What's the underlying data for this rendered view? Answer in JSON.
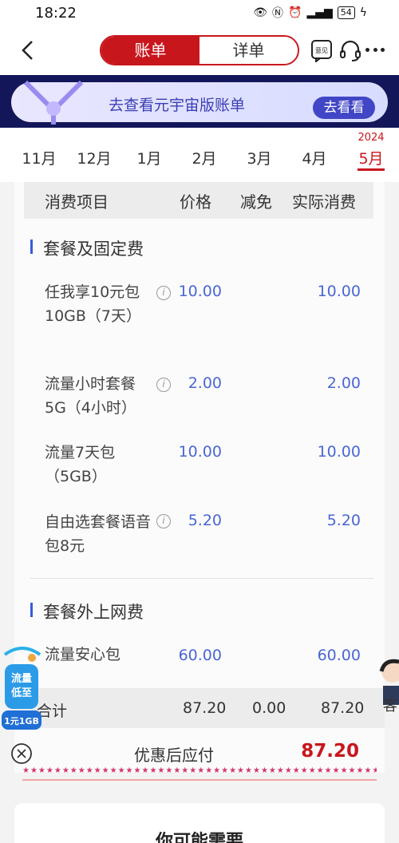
{
  "status_bar": {
    "time": "18:22",
    "battery": "54"
  },
  "header": {
    "tabs": [
      {
        "label": "账单",
        "active": true
      },
      {
        "label": "详单",
        "active": false
      }
    ],
    "badge_icon_label": "意见"
  },
  "banner": {
    "text": "去查看元宇宙版账单",
    "button": "去看看"
  },
  "months": {
    "items": [
      "11月",
      "12月",
      "1月",
      "2月",
      "3月",
      "4月",
      "5月"
    ],
    "active_year": "2024"
  },
  "table": {
    "headers": [
      "消费项目",
      "价格",
      "减免",
      "实际消费"
    ],
    "sections": [
      {
        "title": "套餐及固定费",
        "rows": [
          {
            "name": "任我享10元包10GB（7天）",
            "price": "10.00",
            "actual": "10.00"
          },
          {
            "name": "流量小时套餐5G（4小时）",
            "price": "2.00",
            "actual": "2.00"
          },
          {
            "name": "流量7天包（5GB）",
            "price": "10.00",
            "actual": "10.00"
          },
          {
            "name": "自由选套餐语音包8元",
            "price": "5.20",
            "actual": "5.20"
          }
        ]
      },
      {
        "title": "套餐外上网费",
        "rows": [
          {
            "name": "流量安心包",
            "price": "60.00",
            "actual": "60.00"
          }
        ]
      }
    ],
    "total": {
      "label": "合计",
      "price": "87.20",
      "discount": "0.00",
      "actual": "87.20"
    },
    "pay": {
      "label": "优惠后应付",
      "value": "87.20"
    }
  },
  "promo": {
    "line1": "流量",
    "line2": "低至",
    "line3": "1元1GB"
  },
  "customer_service": {
    "label": "客"
  },
  "recommend": {
    "title": "你可能需要"
  },
  "colors": {
    "brand_red": "#c8161d",
    "price_blue": "#4a66d6",
    "banner_purple": "#4146c6"
  }
}
